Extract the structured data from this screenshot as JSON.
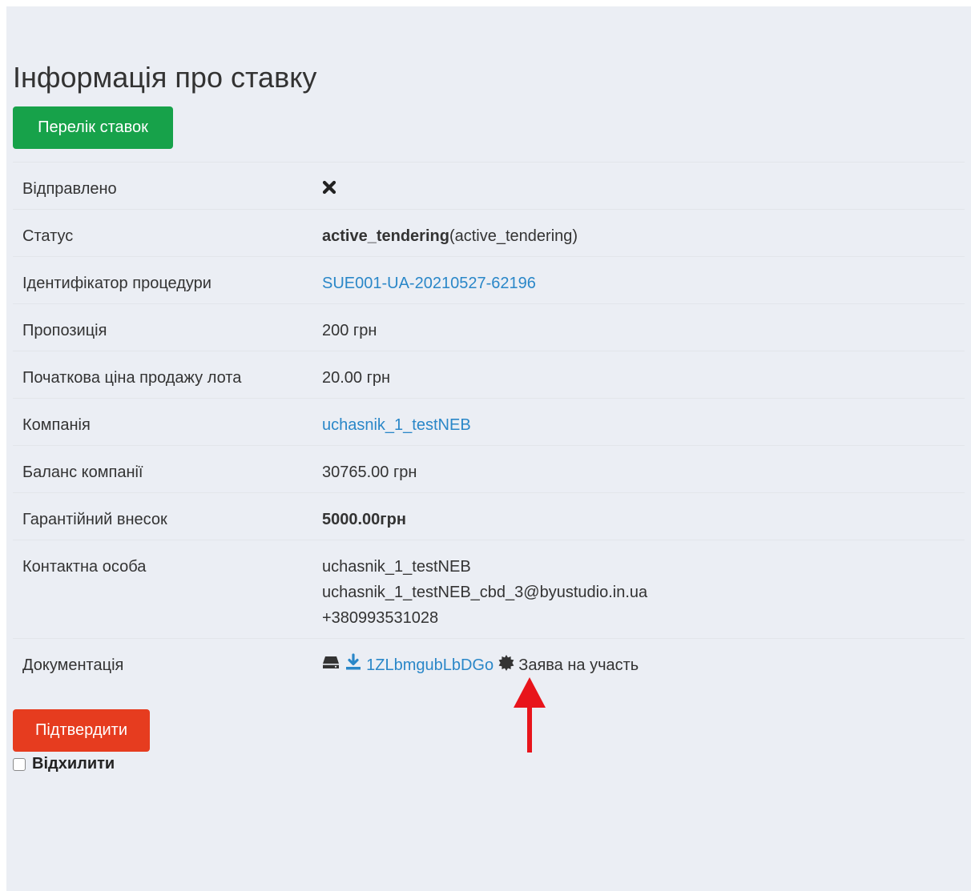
{
  "page": {
    "title": "Інформація про ставку"
  },
  "buttons": {
    "bids_list": "Перелік ставок",
    "confirm": "Підтвердити",
    "decline": "Відхилити"
  },
  "rows": {
    "sent": {
      "label": "Відправлено",
      "icon": "close-icon"
    },
    "status": {
      "label": "Статус",
      "value_bold": "active_tendering",
      "value_rest": "(active_tendering)"
    },
    "procedure_id": {
      "label": "Ідентифікатор процедури",
      "value": "SUE001-UA-20210527-62196"
    },
    "offer": {
      "label": "Пропозиція",
      "value": "200 грн"
    },
    "start_price": {
      "label": "Початкова ціна продажу лота",
      "value": "20.00 грн"
    },
    "company": {
      "label": "Компанія",
      "value": "uchasnik_1_testNEB"
    },
    "balance": {
      "label": "Баланс компанії",
      "value": "30765.00 грн"
    },
    "guarantee": {
      "label": "Гарантійний внесок",
      "value": "5000.00грн"
    },
    "contact": {
      "label": "Контактна особа",
      "name": "uchasnik_1_testNEB",
      "email": "uchasnik_1_testNEB_cbd_3@byustudio.in.ua",
      "phone": "+380993531028"
    },
    "documentation": {
      "label": "Документація",
      "file_name": "1ZLbmgubLbDGo",
      "doc_type": "Заява на участь",
      "icons": [
        "hdd-icon",
        "download-icon",
        "certificate-icon"
      ]
    }
  },
  "colors": {
    "background_panel": "#ebeef4",
    "green_button": "#17a24a",
    "red_button": "#e63c1f",
    "link": "#2a87c8",
    "annotation_arrow": "#e8141b"
  }
}
